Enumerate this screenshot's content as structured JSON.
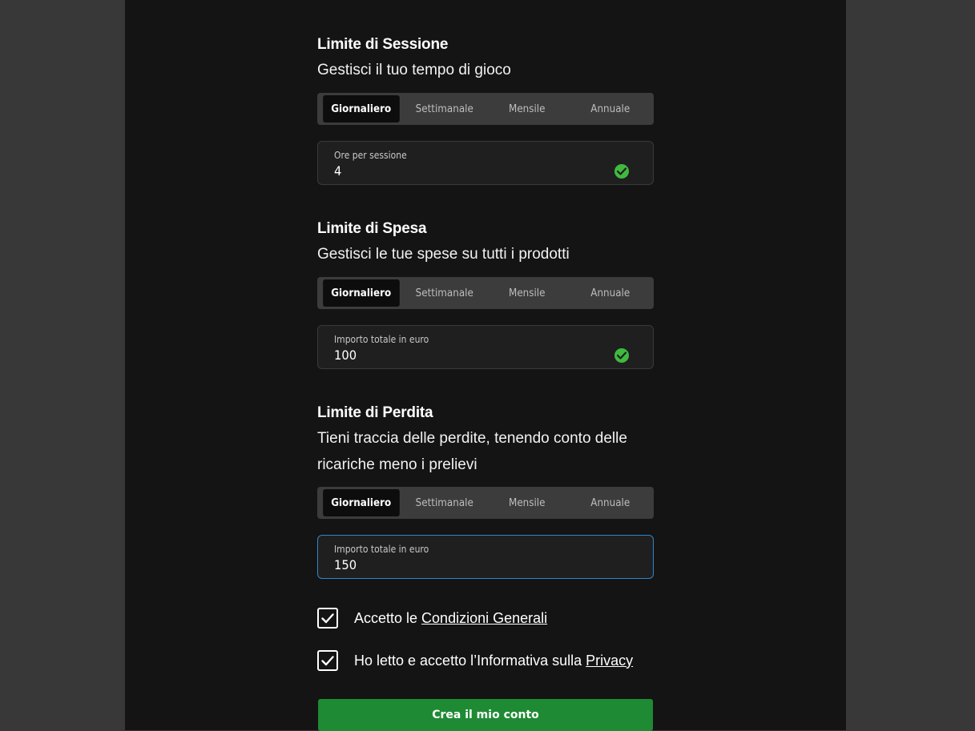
{
  "sections": [
    {
      "title": "Limite di Sessione",
      "subtitle": "Gestisci il tuo tempo di gioco",
      "periods": [
        "Giornaliero",
        "Settimanale",
        "Mensile",
        "Annuale"
      ],
      "selected_period": "Giornaliero",
      "field_label": "Ore per sessione",
      "field_value": "4",
      "valid": true
    },
    {
      "title": "Limite di Spesa",
      "subtitle": "Gestisci le tue spese su tutti i prodotti",
      "periods": [
        "Giornaliero",
        "Settimanale",
        "Mensile",
        "Annuale"
      ],
      "selected_period": "Giornaliero",
      "field_label": "Importo totale in euro",
      "field_value": "100",
      "valid": true
    },
    {
      "title": "Limite di Perdita",
      "subtitle_line1": "Tieni traccia delle perdite, tenendo conto delle",
      "subtitle_line2": "ricariche meno i prelievi",
      "periods": [
        "Giornaliero",
        "Settimanale",
        "Mensile",
        "Annuale"
      ],
      "selected_period": "Giornaliero",
      "field_label": "Importo totale in euro",
      "field_value": "150",
      "focused": true
    }
  ],
  "consents": [
    {
      "prefix": "Accetto le ",
      "link": "Condizioni Generali",
      "checked": true
    },
    {
      "prefix": "Ho letto e accetto l’Informativa sulla ",
      "link": "Privacy",
      "checked": true
    }
  ],
  "submit_label": "Crea il mio conto",
  "colors": {
    "accent_green": "#1f8a34",
    "valid_check": "#3fba3f",
    "focus_border": "#2f86c9",
    "panel_bg": "#141414",
    "page_bg": "#383838"
  }
}
